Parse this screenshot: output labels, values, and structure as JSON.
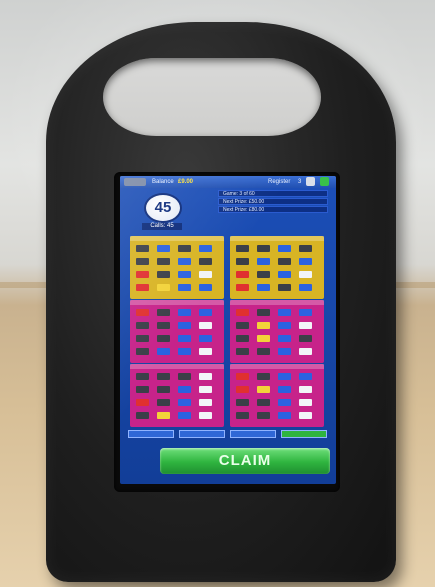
{
  "device": {
    "kind": "photo of bingo terminal in black stand"
  },
  "screen": {
    "topbar": {
      "menu_label": "",
      "balance_label": "Balance",
      "balance_value": "£9.00",
      "register_label": "Register",
      "count": "3"
    },
    "ball": {
      "number": "45"
    },
    "calls_label": "Calls: 45",
    "info_lines": [
      "Game: 3 of 60",
      "Next Prize: £50.00",
      "Next Prize: £80.00"
    ],
    "claim_label": "CLAIM",
    "cards": [
      {
        "color": "#d8b424",
        "cells": [
          [
            "dark",
            "blue",
            "dark",
            "blue"
          ],
          [
            "dark",
            "dark",
            "blue",
            "dark"
          ],
          [
            "red",
            "dark",
            "blue",
            "wht"
          ],
          [
            "red",
            "yel",
            "blue",
            "blue"
          ]
        ]
      },
      {
        "color": "#d8b424",
        "cells": [
          [
            "dark",
            "dark",
            "blue",
            "dark"
          ],
          [
            "dark",
            "blue",
            "dark",
            "blue"
          ],
          [
            "red",
            "dark",
            "blue",
            "wht"
          ],
          [
            "red",
            "blue",
            "dark",
            "blue"
          ]
        ]
      },
      {
        "color": "#c7238a",
        "cells": [
          [
            "red",
            "dark",
            "blue",
            "blue"
          ],
          [
            "dark",
            "dark",
            "blue",
            "wht"
          ],
          [
            "dark",
            "dark",
            "blue",
            "blue"
          ],
          [
            "dark",
            "blue",
            "blue",
            "wht"
          ]
        ]
      },
      {
        "color": "#c7238a",
        "cells": [
          [
            "red",
            "dark",
            "blue",
            "blue"
          ],
          [
            "dark",
            "yel",
            "blue",
            "wht"
          ],
          [
            "dark",
            "yel",
            "blue",
            "dark"
          ],
          [
            "dark",
            "dark",
            "blue",
            "wht"
          ]
        ]
      },
      {
        "color": "#c7238a",
        "cells": [
          [
            "dark",
            "dark",
            "dark",
            "wht"
          ],
          [
            "dark",
            "dark",
            "blue",
            "wht"
          ],
          [
            "red",
            "dark",
            "blue",
            "wht"
          ],
          [
            "dark",
            "yel",
            "blue",
            "wht"
          ]
        ]
      },
      {
        "color": "#c7238a",
        "cells": [
          [
            "red",
            "dark",
            "blue",
            "blue"
          ],
          [
            "red",
            "yel",
            "blue",
            "wht"
          ],
          [
            "dark",
            "dark",
            "blue",
            "wht"
          ],
          [
            "dark",
            "dark",
            "blue",
            "wht"
          ]
        ]
      }
    ],
    "colors": {
      "screen_bg": "#1c4fb8",
      "claim_bg": "#2fb43f",
      "card_gold": "#d8b424",
      "card_magenta": "#c7238a"
    }
  }
}
